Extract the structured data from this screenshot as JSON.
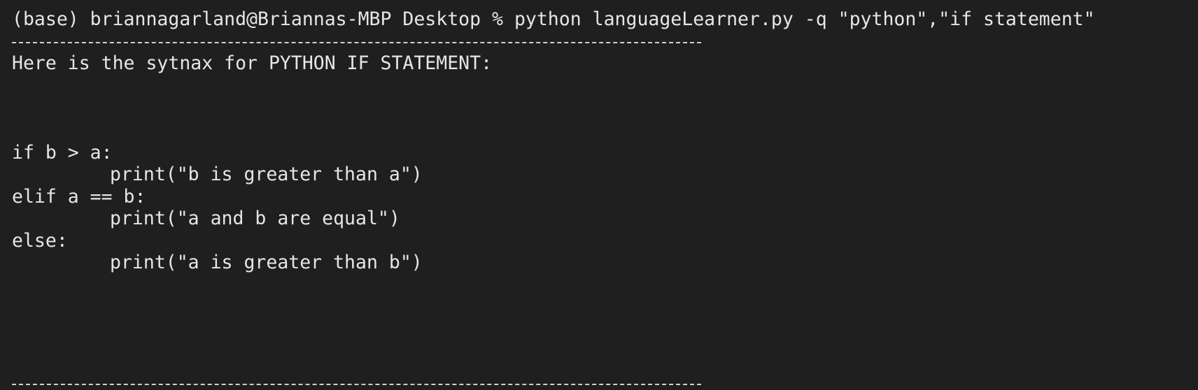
{
  "terminal": {
    "prompt_line": "(base) briannagarland@Briannas-MBP Desktop % python languageLearner.py -q \"python\",\"if statement\"",
    "header_text": "Here is the sytnax for PYTHON IF STATEMENT:",
    "code_lines": [
      "if b > a:",
      "print(\"b is greater than a\")",
      "elif a == b:",
      "print(\"a and b are equal\")",
      "else:",
      "print(\"a is greater than b\")"
    ]
  }
}
